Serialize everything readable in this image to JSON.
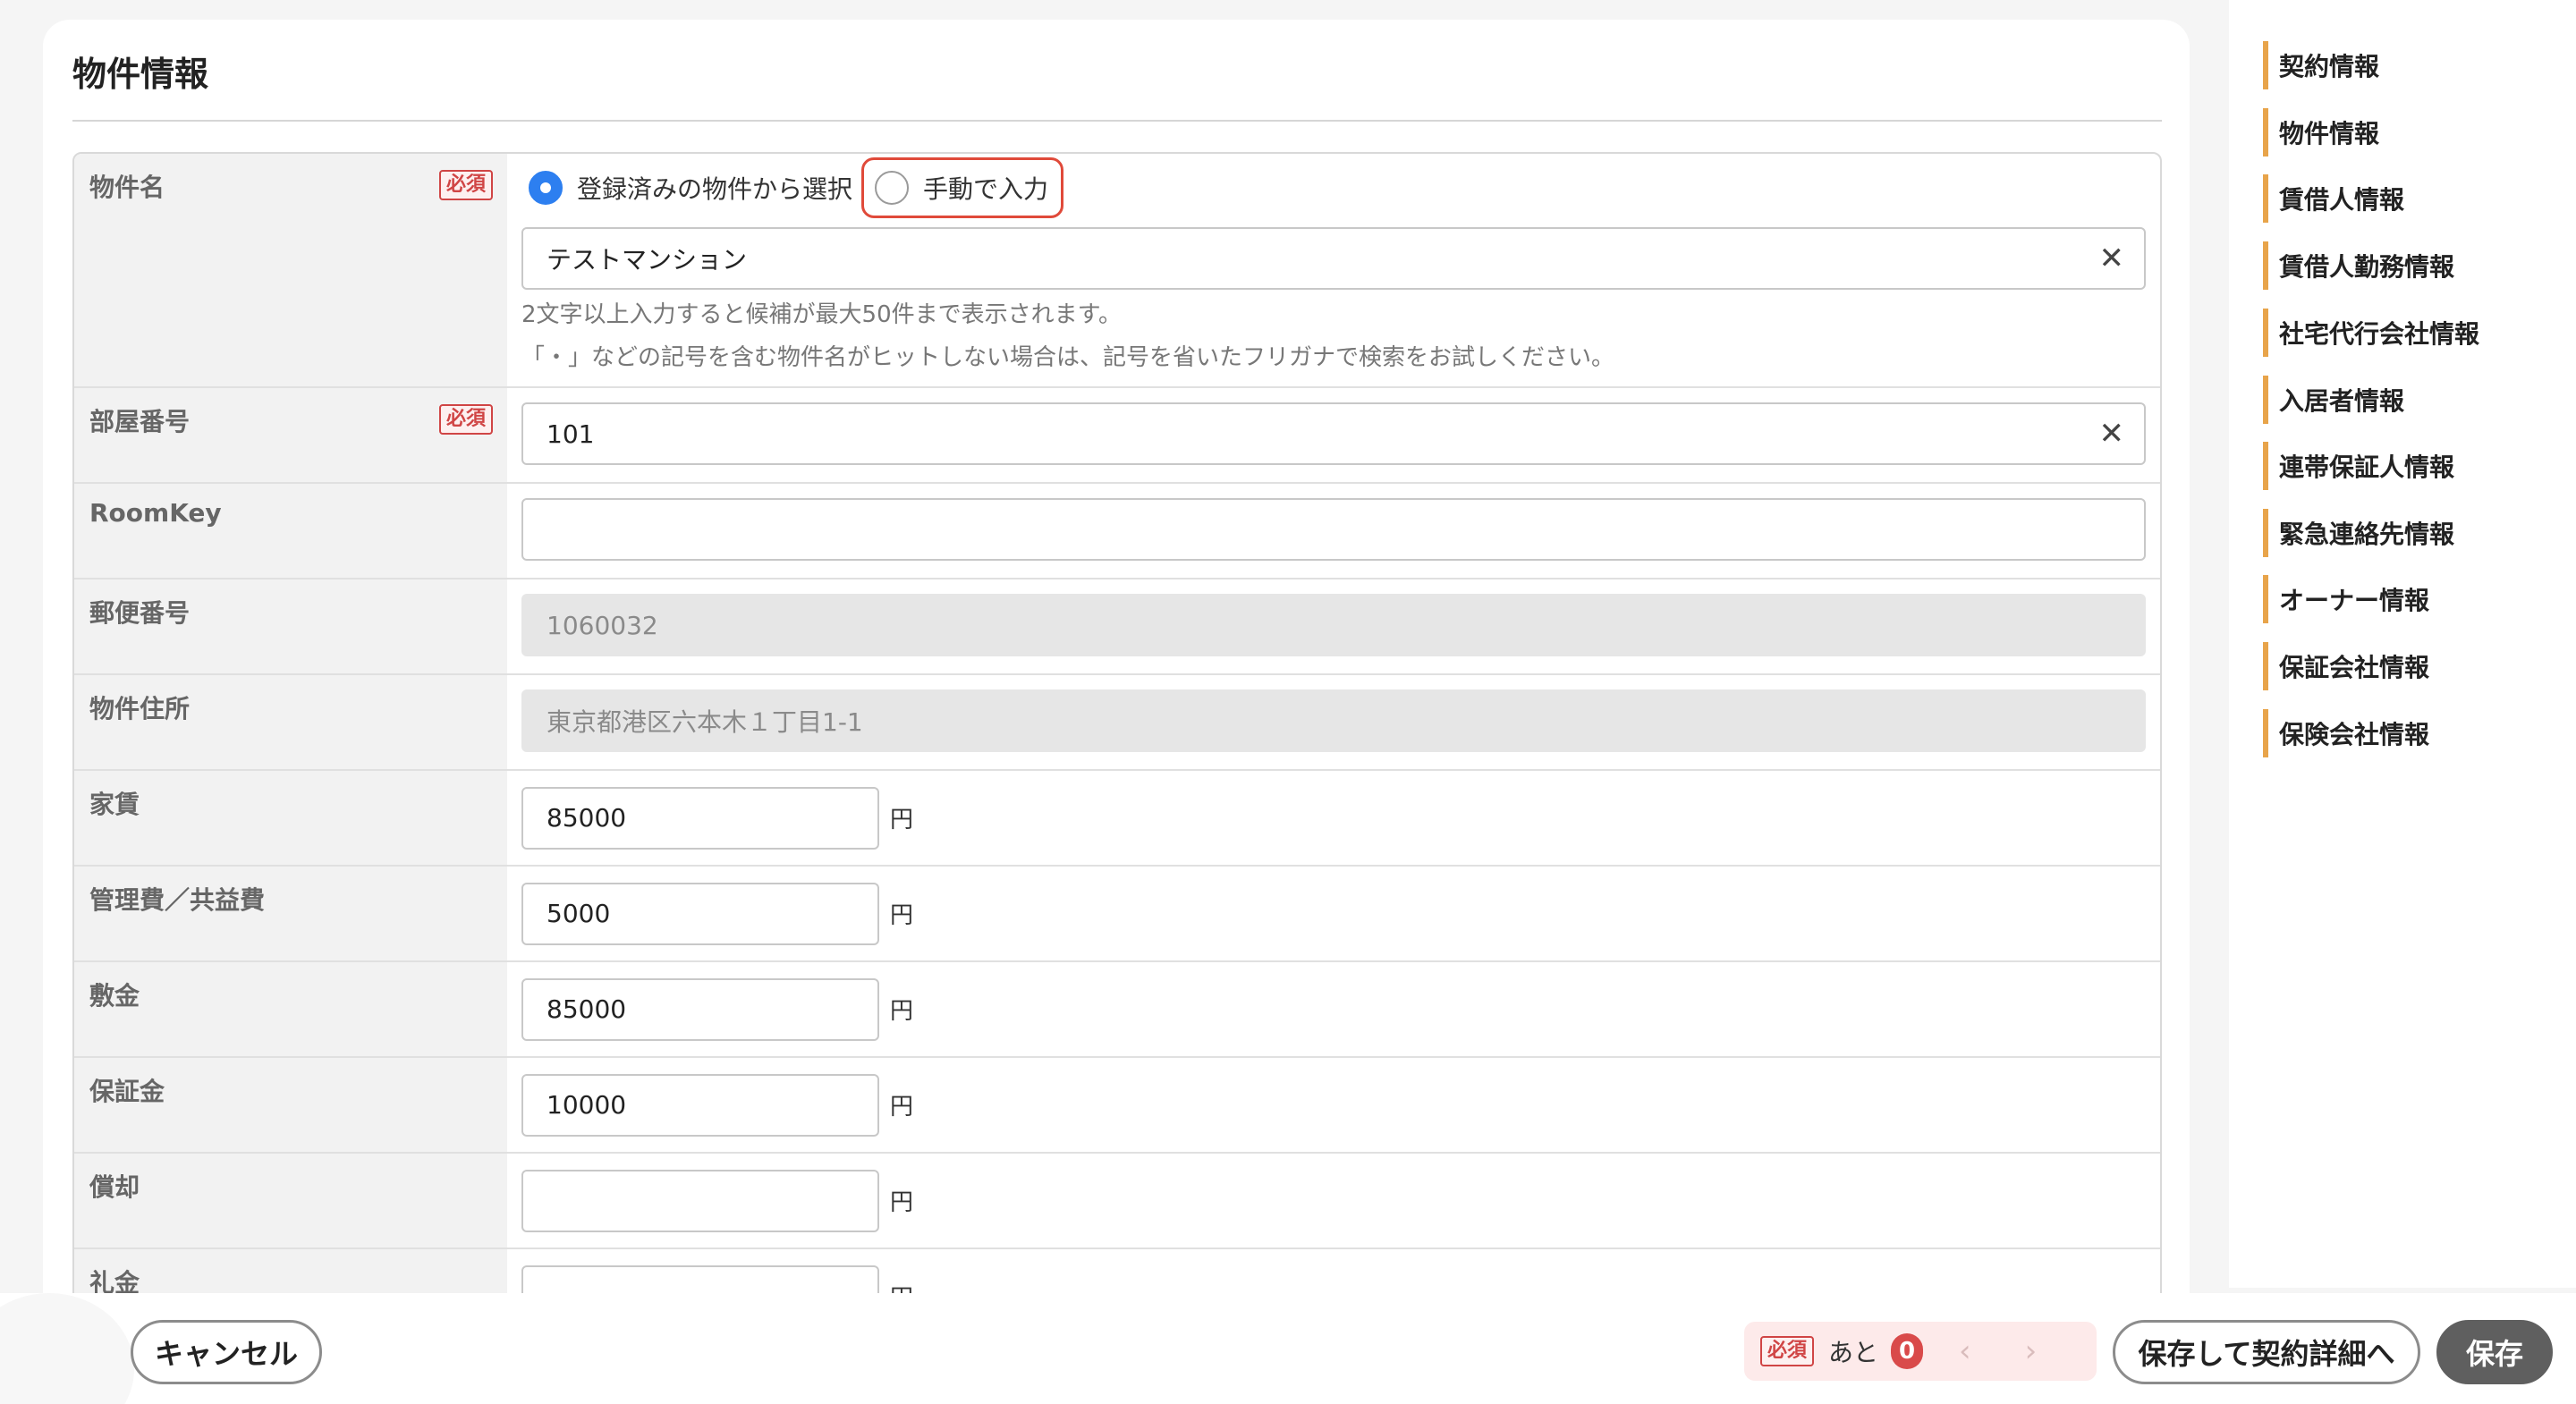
{
  "section": {
    "title": "物件情報"
  },
  "fields": {
    "property_name": {
      "label": "物件名",
      "required_label": "必須",
      "radio_registered": "登録済みの物件から選択",
      "radio_manual": "手動で入力",
      "value": "テストマンション",
      "help_line1": "2文字以上入力すると候補が最大50件まで表示されます。",
      "help_line2": "「・」などの記号を含む物件名がヒットしない場合は、記号を省いたフリガナで検索をお試しください。"
    },
    "room_number": {
      "label": "部屋番号",
      "required_label": "必須",
      "value": "101"
    },
    "room_key": {
      "label": "RoomKey",
      "value": ""
    },
    "postal_code": {
      "label": "郵便番号",
      "value": "1060032"
    },
    "address": {
      "label": "物件住所",
      "value": "東京都港区六本木１丁目1-1"
    },
    "rent": {
      "label": "家賃",
      "value": "85000",
      "unit": "円"
    },
    "management_fee": {
      "label": "管理費／共益費",
      "value": "5000",
      "unit": "円"
    },
    "deposit": {
      "label": "敷金",
      "value": "85000",
      "unit": "円"
    },
    "guarantee_money": {
      "label": "保証金",
      "value": "10000",
      "unit": "円"
    },
    "amortization": {
      "label": "償却",
      "value": "",
      "unit": "円"
    },
    "key_money": {
      "label": "礼金",
      "value": "",
      "unit": "円"
    }
  },
  "sidebar": {
    "items": [
      "契約情報",
      "物件情報",
      "賃借人情報",
      "賃借人勤務情報",
      "社宅代行会社情報",
      "入居者情報",
      "連帯保証人情報",
      "緊急連絡先情報",
      "オーナー情報",
      "保証会社情報",
      "保険会社情報"
    ]
  },
  "footer": {
    "cancel_label": "キャンセル",
    "required_label": "必須",
    "remaining_label": "あと",
    "remaining_count": "0",
    "prev_icon": "‹",
    "next_icon": "›",
    "save_and_detail_label": "保存して契約詳細へ",
    "save_label": "保存"
  },
  "colors": {
    "accent": "#2d7ff0",
    "required": "#d04545",
    "nav_bar": "#e8a44a",
    "highlight": "#e04a3a"
  }
}
